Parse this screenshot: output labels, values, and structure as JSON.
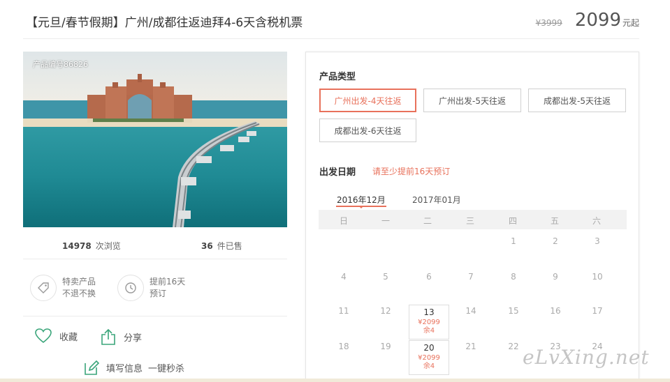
{
  "header": {
    "title": "【元旦/春节假期】广州/成都往返迪拜4-6天含税机票",
    "original_price": "¥3999",
    "price": "2099",
    "price_unit": "元起"
  },
  "product": {
    "number_label": "产品编号86826",
    "views_count": "14978",
    "views_label": "次浏览",
    "sold_count": "36",
    "sold_label": "件已售"
  },
  "features": [
    {
      "icon": "tag-icon",
      "line1": "特卖产品",
      "line2": "不退不换"
    },
    {
      "icon": "clock-icon",
      "line1": "提前16天",
      "line2": "预订"
    }
  ],
  "actions": {
    "favorite": "收藏",
    "share": "分享",
    "fill_info": "填写信息",
    "flash_sale": "一键秒杀"
  },
  "booking": {
    "type_label": "产品类型",
    "options": [
      "广州出发-4天往返",
      "广州出发-5天往返",
      "成都出发-5天往返",
      "成都出发-6天往返"
    ],
    "selected_option": 0,
    "date_label": "出发日期",
    "notice": "请至少提前16天预订",
    "months": [
      "2016年12月",
      "2017年01月"
    ],
    "selected_month": 0,
    "weekdays": [
      "日",
      "一",
      "二",
      "三",
      "四",
      "五",
      "六"
    ],
    "weeks": [
      [
        "",
        "",
        "",
        "",
        "1",
        "2",
        "3"
      ],
      [
        "4",
        "5",
        "6",
        "7",
        "8",
        "9",
        "10"
      ],
      [
        "11",
        "12",
        "13",
        "14",
        "15",
        "16",
        "17"
      ],
      [
        "18",
        "19",
        "20",
        "21",
        "22",
        "23",
        "24"
      ]
    ],
    "available": {
      "13": {
        "price": "¥2099",
        "left": "余4"
      },
      "20": {
        "price": "¥2099",
        "left": "余4"
      }
    }
  },
  "watermark": "eLvXing.net",
  "colors": {
    "accent": "#e8715b",
    "icon_green": "#3aa57a"
  }
}
